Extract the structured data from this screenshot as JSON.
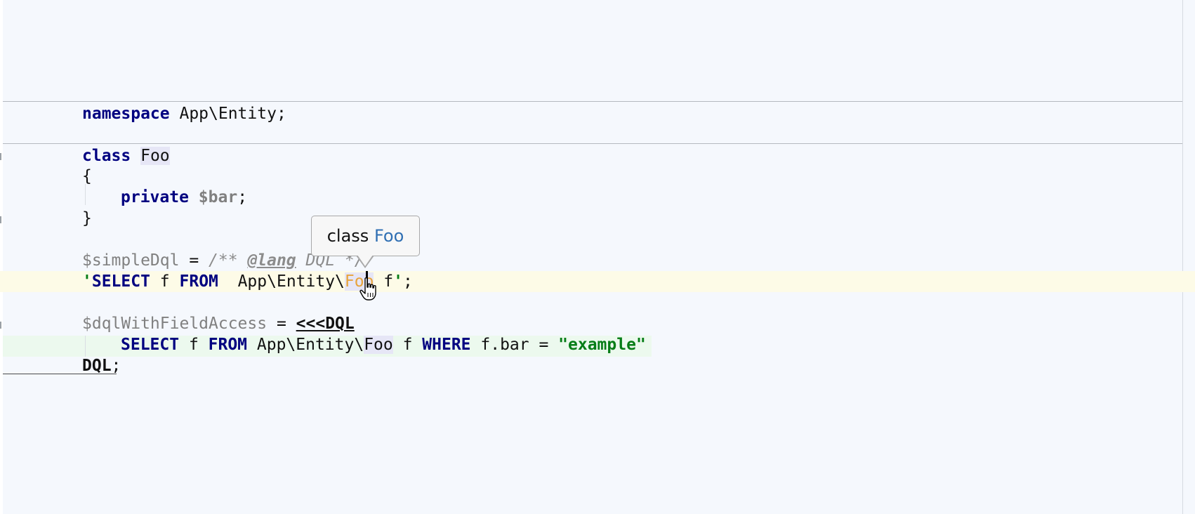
{
  "code": {
    "namespace_kw": "namespace",
    "namespace_name": " App\\Entity;",
    "class_kw": "class",
    "class_name": "Foo",
    "open_brace": "{",
    "private_kw": "private",
    "bar_var": "$bar",
    "semicolon": ";",
    "close_brace": "}",
    "simple_var": "$simpleDql",
    "assign": " = ",
    "comment_open": "/** ",
    "lang_tag": "@lang",
    "comment_rest": " DQL */",
    "quote": "'",
    "select_kw": "SELECT",
    "f_alias": " f ",
    "from_kw": "FROM",
    "entity_path": "  App\\Entity\\",
    "foo_ref": "Foo",
    "alias_end": " f",
    "stmt_end": ";",
    "dql_var": "$dqlWithFieldAccess",
    "heredoc_open": "<<<DQL",
    "select_kw2": "SELECT",
    "from_kw2": "FROM",
    "entity_path2": " App\\Entity\\",
    "foo_ref2": "Foo",
    "where_kw": "WHERE",
    "field_access": " f.bar = ",
    "example_str": "\"example\"",
    "heredoc_close": "DQL"
  },
  "tooltip": {
    "kind": "class",
    "name": "Foo"
  },
  "colors": {
    "keyword": "#000080",
    "string": "#067d17",
    "hover_reference": "#e8a33a",
    "tooltip_link": "#2f6fb3",
    "current_line": "#fdfbe7",
    "injection_background": "#ecf9ee"
  },
  "icons": {
    "cursor": "hand-pointer-icon"
  }
}
